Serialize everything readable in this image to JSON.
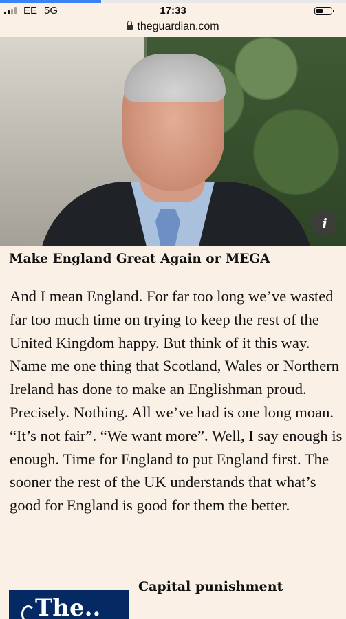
{
  "status_bar": {
    "carrier": "EE",
    "network": "5G",
    "time": "17:33"
  },
  "browser": {
    "url": "theguardian.com"
  },
  "hero": {
    "info_label": "i"
  },
  "article": {
    "subheading": "Make England Great Again or MEGA",
    "body": "And I mean England. For far too long we’ve wasted far too much time on trying to keep the rest of the United Kingdom happy. But think of it this way. Name me one thing that Scotland, Wales or Northern Ireland has done to make an Englishman proud. Precisely. Nothing. All we’ve had is one long moan. “It’s not fair”. “We want more”. Well, I say enough is enough. Time for England to put England first. The sooner the rest of the UK understands that what’s good for England is good for them the better."
  },
  "related": {
    "logo_text": "The..",
    "title": "Capital punishment"
  },
  "colors": {
    "page_background": "#fbf0e6",
    "guardian_navy": "#052962",
    "loading_bar": "#3b82f6"
  }
}
